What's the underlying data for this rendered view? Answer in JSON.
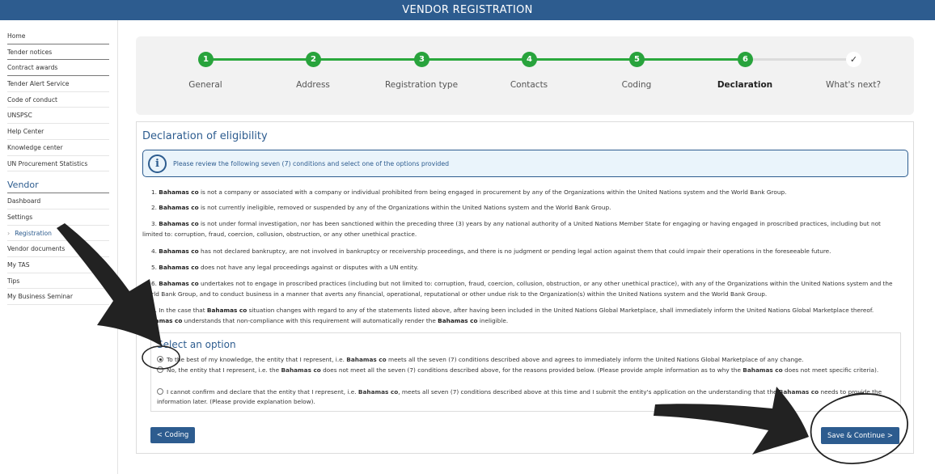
{
  "header": {
    "title": "VENDOR REGISTRATION"
  },
  "sidebar": {
    "top_items": [
      "Home",
      "Tender notices",
      "Contract awards",
      "Tender Alert Service",
      "Code of conduct",
      "UNSPSC",
      "Help Center",
      "Knowledge center",
      "UN Procurement Statistics"
    ],
    "section_title": "Vendor",
    "vendor_items": [
      "Dashboard",
      "Settings",
      "Registration",
      "Vendor documents",
      "My TAS",
      "Tips",
      "My Business Seminar"
    ],
    "active_item": "Registration"
  },
  "stepper": {
    "steps": [
      {
        "number": "1",
        "label": "General"
      },
      {
        "number": "2",
        "label": "Address"
      },
      {
        "number": "3",
        "label": "Registration type"
      },
      {
        "number": "4",
        "label": "Contacts"
      },
      {
        "number": "5",
        "label": "Coding"
      },
      {
        "number": "6",
        "label": "Declaration"
      },
      {
        "number": "✓",
        "label": "What's next?"
      }
    ],
    "current": "Declaration"
  },
  "declaration": {
    "title": "Declaration of eligibility",
    "info": "Please review the following seven (7) conditions and select one of the options provided",
    "entity": "Bahamas co",
    "conditions": [
      {
        "num": "1.",
        "text": " is not a company or associated with a company or individual prohibited from being engaged in procurement by any of the Organizations within the United Nations system and the World Bank Group."
      },
      {
        "num": "2.",
        "text": " is not currently ineligible, removed or suspended by any of the Organizations within the United Nations system and the World Bank Group."
      },
      {
        "num": "3.",
        "text": " is not under formal investigation, nor has been sanctioned within the preceding three (3) years by any national authority of a United Nations Member State for engaging or having engaged in proscribed practices, including but not limited to: corruption, fraud, coercion, collusion, obstruction, or any other unethical practice."
      },
      {
        "num": "4.",
        "text": " has not declared bankruptcy, are not involved in bankruptcy or receivership proceedings, and there is no judgment or pending legal action against them that could impair their operations in the foreseeable future."
      },
      {
        "num": "5.",
        "text": " does not have any legal proceedings against or disputes with a UN entity."
      },
      {
        "num": "6.",
        "text": " undertakes not to engage in proscribed practices (including but not limited to: corruption, fraud, coercion, collusion, obstruction, or any other unethical practice), with any of the Organizations within the United Nations system and the World Bank Group, and to conduct business in a manner that averts any financial, operational, reputational or other undue risk to the Organization(s) within the United Nations system and the World Bank Group."
      }
    ],
    "condition7_prefix": "7.  In the case that ",
    "condition7_mid": " situation changes with regard to any of the statements listed above, after having been included in the United Nations Global Marketplace, shall immediately inform the United Nations Global Marketplace thereof. ",
    "condition7_mid2": " understands that non-compliance with this requirement will automatically render the ",
    "condition7_end": " ineligible."
  },
  "options": {
    "title": "Select an option",
    "option1_a": "To the best of my knowledge, the entity that I represent, i.e. ",
    "option1_b": " meets all the seven (7) conditions described above and agrees to immediately inform the United Nations Global Marketplace of any change.",
    "option2_a": "No, the entity that I represent, i.e. the ",
    "option2_b": " does not meet all the seven (7) conditions described above, for the reasons provided below. (Please provide ample information as to why the ",
    "option2_c": " does not meet specific criteria).",
    "option3_a": "I cannot confirm and declare that the entity that I represent, i.e. ",
    "option3_b": ", meets all seven (7) conditions described above at this time and I submit the entity's application on the understanding that the ",
    "option3_c": " needs to provide the information later. (Please provide explanation below).",
    "selected": 1
  },
  "buttons": {
    "back": "< Coding",
    "next": "Save & Continue >"
  },
  "colors": {
    "brand": "#2d5c8f",
    "step_green": "#28a33c",
    "annotation": "#222222"
  }
}
